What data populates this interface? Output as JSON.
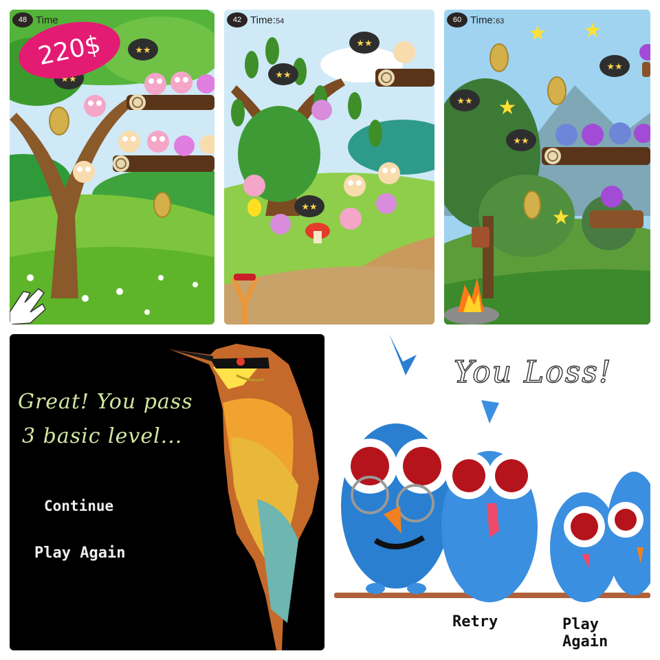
{
  "level_1": {
    "level": "48",
    "time_label": "Time",
    "money": "220$"
  },
  "level_2": {
    "level": "42",
    "time_label": "Time:",
    "time_value": "54"
  },
  "level_3": {
    "level": "60",
    "time_label": "Time:",
    "time_value": "63"
  },
  "pass_screen": {
    "message_line1": "Great! You pass",
    "message_line2": "3 basic level...",
    "continue_label": "Continue",
    "play_again_label": "Play Again"
  },
  "loss_screen": {
    "title": "You Loss!",
    "retry_label": "Retry",
    "play_again_label": "Play Again"
  }
}
